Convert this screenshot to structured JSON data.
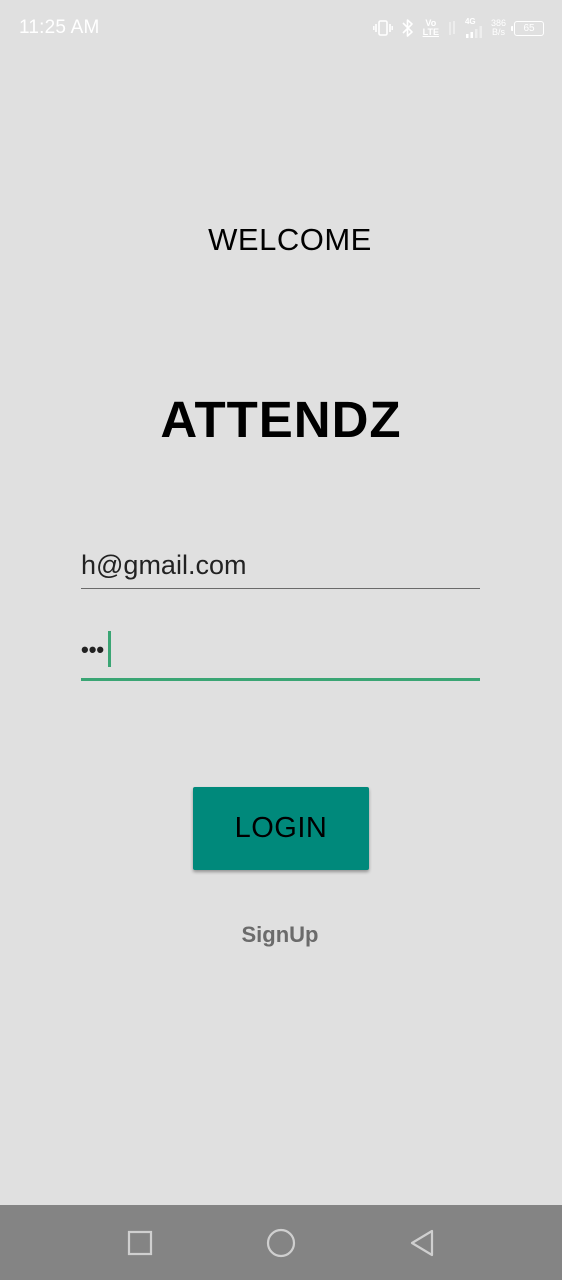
{
  "status_bar": {
    "time": "11:25 AM",
    "network_type": "4G",
    "volte_line1": "Vo",
    "volte_line2": "LTE",
    "speed_value": "386",
    "speed_unit": "B/s",
    "battery": "65"
  },
  "screen": {
    "welcome": "WELCOME",
    "app_title": "ATTENDZ",
    "email_value": "h@gmail.com",
    "password_display": "•••",
    "login_label": "LOGIN",
    "signup_label": "SignUp"
  },
  "colors": {
    "background": "#e0e0e0",
    "accent": "#00897b",
    "focus_underline": "#3aa574",
    "nav_bar": "#848484"
  },
  "icons": {
    "vibrate": "vibrate-icon",
    "bluetooth": "bluetooth-icon",
    "signal": "signal-icon",
    "battery": "battery-icon",
    "recents": "recents-icon",
    "home": "home-icon",
    "back": "back-icon"
  }
}
